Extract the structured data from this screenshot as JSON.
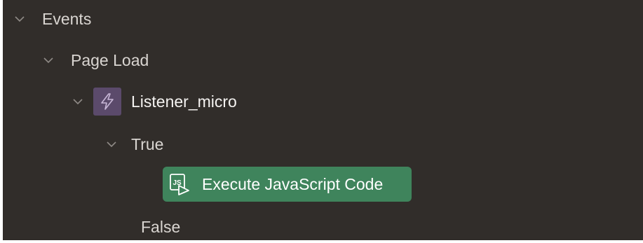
{
  "tree": {
    "events": {
      "label": "Events",
      "icon": "chevron-down-icon"
    },
    "page_load": {
      "label": "Page Load",
      "icon": "chevron-down-icon"
    },
    "listener": {
      "label": "Listener_micro",
      "icon": "lightning-bolt-icon",
      "badge_color": "#5b4a6b"
    },
    "true_branch": {
      "label": "True",
      "icon": "chevron-down-icon"
    },
    "action": {
      "label": "Execute JavaScript Code",
      "icon": "javascript-code-icon",
      "color": "#3f845c"
    },
    "false_branch": {
      "label": "False"
    }
  },
  "colors": {
    "panel_background": "#312d2a",
    "text": "#d9d5d1",
    "selected_action": "#3f845c"
  }
}
